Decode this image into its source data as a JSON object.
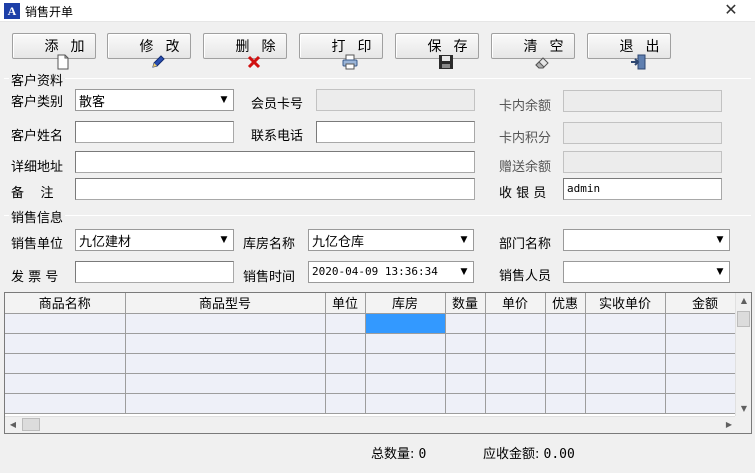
{
  "window": {
    "title": "销售开单",
    "app_icon_letter": "A",
    "close_glyph": "✕"
  },
  "toolbar": {
    "add": "添  加",
    "edit": "修  改",
    "delete": "删  除",
    "print": "打  印",
    "save": "保  存",
    "clear": "清  空",
    "exit": "退  出"
  },
  "customer": {
    "group_title": "客户资料",
    "type_label": "客户类别",
    "type_value": "散客",
    "card_label": "会员卡号",
    "card_value": "",
    "balance_label": "卡内余额",
    "balance_value": "",
    "name_label": "客户姓名",
    "name_value": "",
    "phone_label": "联系电话",
    "phone_value": "",
    "points_label": "卡内积分",
    "points_value": "",
    "address_label": "详细地址",
    "address_value": "",
    "gift_label": "赠送余额",
    "gift_value": "",
    "remark_label": "备    注",
    "remark_value": "",
    "cashier_label": "收 银 员",
    "cashier_value": "admin"
  },
  "sales": {
    "group_title": "销售信息",
    "unit_label": "销售单位",
    "unit_value": "九亿建材",
    "warehouse_label": "库房名称",
    "warehouse_value": "九亿仓库",
    "dept_label": "部门名称",
    "dept_value": "",
    "invoice_label": "发 票 号",
    "invoice_value": "",
    "time_label": "销售时间",
    "time_value": "2020-04-09 13:36:34",
    "staff_label": "销售人员",
    "staff_value": ""
  },
  "grid": {
    "columns": [
      "商品名称",
      "商品型号",
      "单位",
      "库房",
      "数量",
      "单价",
      "优惠",
      "实收单价",
      "金额"
    ],
    "row_count": 5
  },
  "summary": {
    "total_qty_label": "总数量:",
    "total_qty_value": "0",
    "receivable_label": "应收金额:",
    "receivable_value": "0.00"
  },
  "colors": {
    "selected_cell": "#3399ff",
    "grid_row_bg": "#eef0f8",
    "app_icon_bg": "#1d3fa8"
  }
}
